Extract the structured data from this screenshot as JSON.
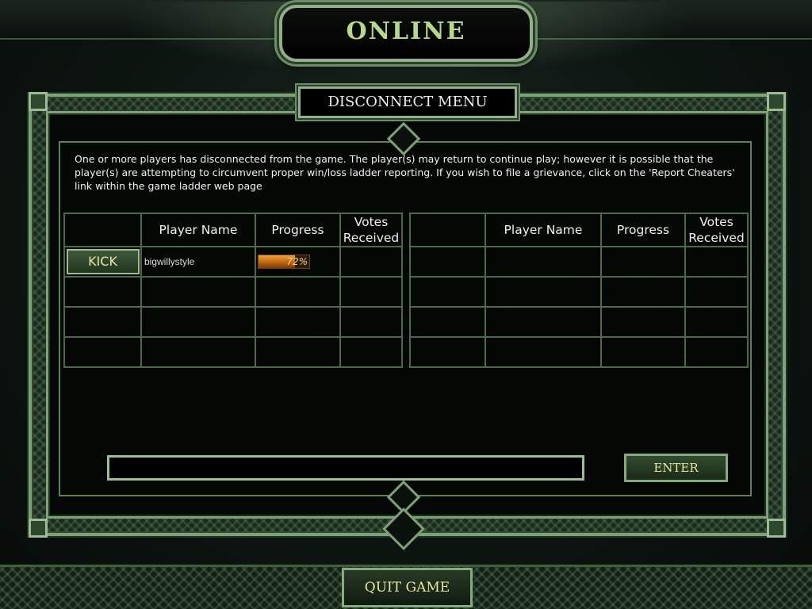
{
  "screen": {
    "title": "ONLINE",
    "header": "DISCONNECT MENU"
  },
  "message": "One or more players has disconnected from the game.  The player(s) may return to continue play; however it is possible that the player(s) are attempting to circumvent proper win/loss ladder reporting.  If you wish to file a grievance, click on the 'Report Cheaters' link within the game ladder web page",
  "table": {
    "headers": {
      "player_name": "Player Name",
      "progress": "Progress",
      "votes_line1": "Votes",
      "votes_line2": "Received"
    },
    "left_rows": [
      {
        "action": "KICK",
        "player": "bigwillystyle",
        "progress_text": "72%",
        "progress_value": 0.72,
        "votes": ""
      }
    ]
  },
  "chat": {
    "value": "",
    "enter_label": "ENTER"
  },
  "footer": {
    "quit_label": "QUIT GAME"
  },
  "colors": {
    "frame_green": "#7ea277",
    "button_text": "#e8e6a0",
    "progress_orange": "#e08a2a"
  }
}
